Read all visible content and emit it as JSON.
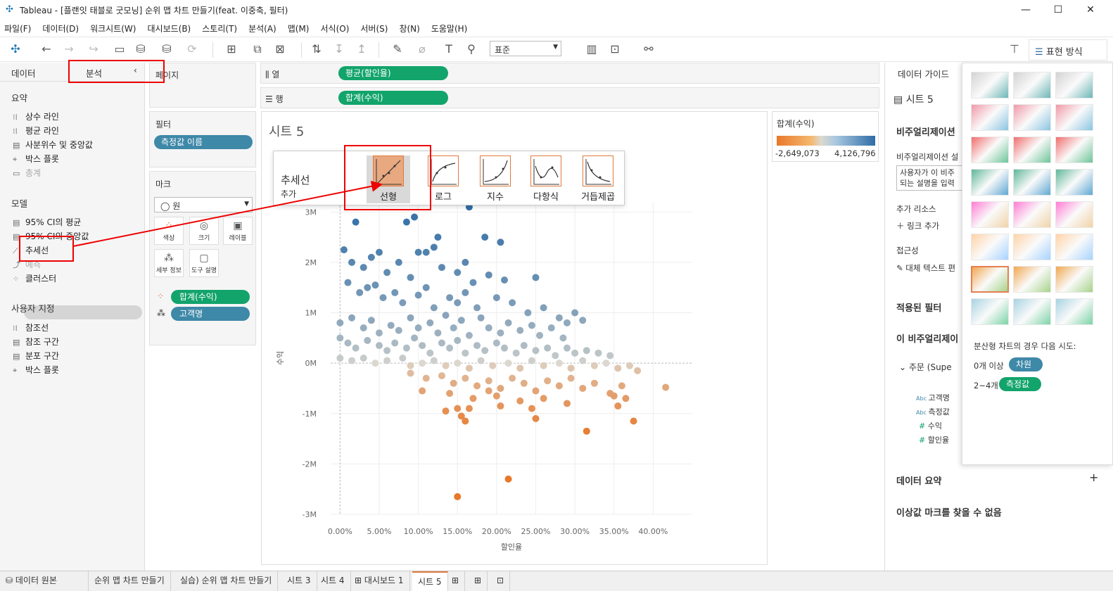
{
  "window": {
    "title": "Tableau - [플랜잇 태블로 굿모닝] 순위 맵 차트 만들기(feat. 이중축, 필터)",
    "min": "—",
    "max": "☐",
    "close": "✕"
  },
  "menu": [
    "파일(F)",
    "데이터(D)",
    "워크시트(W)",
    "대시보드(B)",
    "스토리(T)",
    "분석(A)",
    "맵(M)",
    "서식(O)",
    "서버(S)",
    "창(N)",
    "도움말(H)"
  ],
  "toolbar": {
    "fit": "표준",
    "showme": "표현 방식"
  },
  "left": {
    "tab_data": "데이터",
    "tab_analysis": "분석",
    "sections": {
      "summary": "요약",
      "model": "모델",
      "custom": "사용자 지정"
    },
    "summary_items": [
      "상수 라인",
      "평균 라인",
      "사분위수 및 중앙값",
      "박스 플롯",
      "총계"
    ],
    "model_items": [
      "95% CI의 평균",
      "95% CI의 중앙값",
      "추세선",
      "예측",
      "클러스터"
    ],
    "custom_items": [
      "참조선",
      "참조 구간",
      "분포 구간",
      "박스 플롯"
    ]
  },
  "shelves": {
    "pages": "페이지",
    "filters": "필터",
    "filter_pill": "측정값 이름",
    "marks": "마크",
    "mark_type": "원",
    "mark_buttons": [
      "색상",
      "크기",
      "레이블",
      "세부 정보",
      "도구 설명"
    ],
    "mark_pills": [
      "합계(수익)",
      "고객명"
    ],
    "columns_label": "열",
    "rows_label": "행",
    "columns_pill": "평균(할인율)",
    "rows_pill": "합계(수익)"
  },
  "sheet": {
    "title": "시트 5"
  },
  "legend": {
    "title": "합계(수익)",
    "min": "-2,649,073",
    "max": "4,126,796"
  },
  "trend_popup": {
    "title": "추세선",
    "subtitle": "추가",
    "models": [
      "선형",
      "로그",
      "지수",
      "다항식",
      "거듭제곱"
    ]
  },
  "chart_data": {
    "type": "scatter",
    "xlabel": "할인율",
    "ylabel": "수익",
    "x_ticks": [
      "0.00%",
      "5.00%",
      "10.00%",
      "15.00%",
      "20.00%",
      "25.00%",
      "30.00%",
      "35.00%",
      "40.00%"
    ],
    "y_ticks": [
      "3M",
      "2M",
      "1M",
      "0M",
      "-1M",
      "-2M",
      "-3M"
    ],
    "xlim": [
      -0.012,
      0.45
    ],
    "ylim": [
      -3.0,
      3.2
    ],
    "points": [
      [
        0.02,
        2.8
      ],
      [
        0.045,
        3.2
      ],
      [
        0.06,
        3.2
      ],
      [
        0.085,
        2.8
      ],
      [
        0.095,
        2.9
      ],
      [
        0.11,
        2.2
      ],
      [
        0.125,
        2.5
      ],
      [
        0.165,
        3.1
      ],
      [
        0.185,
        2.5
      ],
      [
        0.205,
        2.4
      ],
      [
        0.005,
        2.25
      ],
      [
        0.015,
        2.0
      ],
      [
        0.03,
        1.9
      ],
      [
        0.04,
        2.1
      ],
      [
        0.05,
        2.2
      ],
      [
        0.06,
        1.8
      ],
      [
        0.075,
        2.0
      ],
      [
        0.09,
        1.7
      ],
      [
        0.1,
        2.2
      ],
      [
        0.12,
        2.3
      ],
      [
        0.13,
        1.9
      ],
      [
        0.15,
        1.8
      ],
      [
        0.16,
        2.0
      ],
      [
        0.17,
        1.6
      ],
      [
        0.19,
        1.75
      ],
      [
        0.21,
        1.65
      ],
      [
        0.25,
        1.7
      ],
      [
        0.01,
        1.6
      ],
      [
        0.025,
        1.4
      ],
      [
        0.035,
        1.5
      ],
      [
        0.045,
        1.55
      ],
      [
        0.055,
        1.3
      ],
      [
        0.07,
        1.4
      ],
      [
        0.08,
        1.2
      ],
      [
        0.1,
        1.35
      ],
      [
        0.11,
        1.5
      ],
      [
        0.12,
        1.1
      ],
      [
        0.14,
        1.3
      ],
      [
        0.15,
        1.2
      ],
      [
        0.16,
        1.4
      ],
      [
        0.175,
        1.1
      ],
      [
        0.2,
        1.3
      ],
      [
        0.22,
        1.2
      ],
      [
        0.24,
        1.0
      ],
      [
        0.26,
        1.1
      ],
      [
        0.28,
        0.9
      ],
      [
        0.29,
        0.8
      ],
      [
        0.3,
        1.0
      ],
      [
        0.31,
        0.85
      ],
      [
        0.0,
        0.8
      ],
      [
        0.015,
        0.9
      ],
      [
        0.03,
        0.7
      ],
      [
        0.04,
        0.85
      ],
      [
        0.05,
        0.6
      ],
      [
        0.065,
        0.75
      ],
      [
        0.075,
        0.65
      ],
      [
        0.09,
        0.9
      ],
      [
        0.1,
        0.7
      ],
      [
        0.115,
        0.8
      ],
      [
        0.125,
        0.6
      ],
      [
        0.135,
        0.95
      ],
      [
        0.145,
        0.7
      ],
      [
        0.155,
        0.85
      ],
      [
        0.165,
        0.55
      ],
      [
        0.18,
        0.9
      ],
      [
        0.19,
        0.7
      ],
      [
        0.205,
        0.6
      ],
      [
        0.215,
        0.8
      ],
      [
        0.23,
        0.65
      ],
      [
        0.245,
        0.75
      ],
      [
        0.255,
        0.55
      ],
      [
        0.27,
        0.7
      ],
      [
        0.285,
        0.5
      ],
      [
        0.0,
        0.5
      ],
      [
        0.01,
        0.4
      ],
      [
        0.02,
        0.3
      ],
      [
        0.035,
        0.45
      ],
      [
        0.05,
        0.35
      ],
      [
        0.06,
        0.25
      ],
      [
        0.07,
        0.4
      ],
      [
        0.085,
        0.3
      ],
      [
        0.095,
        0.5
      ],
      [
        0.105,
        0.35
      ],
      [
        0.115,
        0.2
      ],
      [
        0.13,
        0.4
      ],
      [
        0.14,
        0.3
      ],
      [
        0.15,
        0.45
      ],
      [
        0.16,
        0.2
      ],
      [
        0.175,
        0.35
      ],
      [
        0.185,
        0.25
      ],
      [
        0.2,
        0.4
      ],
      [
        0.21,
        0.3
      ],
      [
        0.225,
        0.2
      ],
      [
        0.235,
        0.35
      ],
      [
        0.25,
        0.25
      ],
      [
        0.265,
        0.3
      ],
      [
        0.275,
        0.15
      ],
      [
        0.29,
        0.3
      ],
      [
        0.3,
        0.2
      ],
      [
        0.315,
        0.25
      ],
      [
        0.33,
        0.2
      ],
      [
        0.345,
        0.15
      ],
      [
        0.0,
        0.1
      ],
      [
        0.015,
        0.05
      ],
      [
        0.03,
        0.1
      ],
      [
        0.045,
        0.0
      ],
      [
        0.06,
        0.05
      ],
      [
        0.08,
        0.1
      ],
      [
        0.09,
        -0.05
      ],
      [
        0.105,
        0.0
      ],
      [
        0.12,
        0.05
      ],
      [
        0.135,
        -0.05
      ],
      [
        0.15,
        0.0
      ],
      [
        0.165,
        -0.1
      ],
      [
        0.18,
        0.05
      ],
      [
        0.195,
        -0.05
      ],
      [
        0.215,
        0.0
      ],
      [
        0.23,
        -0.1
      ],
      [
        0.245,
        0.05
      ],
      [
        0.26,
        -0.05
      ],
      [
        0.28,
        0.0
      ],
      [
        0.295,
        -0.1
      ],
      [
        0.31,
        0.05
      ],
      [
        0.325,
        -0.05
      ],
      [
        0.34,
        0.0
      ],
      [
        0.355,
        -0.1
      ],
      [
        0.37,
        -0.05
      ],
      [
        0.38,
        -0.15
      ],
      [
        0.09,
        -0.2
      ],
      [
        0.11,
        -0.3
      ],
      [
        0.13,
        -0.25
      ],
      [
        0.145,
        -0.4
      ],
      [
        0.16,
        -0.3
      ],
      [
        0.175,
        -0.45
      ],
      [
        0.19,
        -0.35
      ],
      [
        0.205,
        -0.5
      ],
      [
        0.22,
        -0.3
      ],
      [
        0.235,
        -0.4
      ],
      [
        0.25,
        -0.55
      ],
      [
        0.265,
        -0.35
      ],
      [
        0.28,
        -0.45
      ],
      [
        0.295,
        -0.3
      ],
      [
        0.31,
        -0.5
      ],
      [
        0.325,
        -0.4
      ],
      [
        0.345,
        -0.6
      ],
      [
        0.36,
        -0.45
      ],
      [
        0.105,
        -0.55
      ],
      [
        0.14,
        -0.6
      ],
      [
        0.17,
        -0.7
      ],
      [
        0.2,
        -0.65
      ],
      [
        0.23,
        -0.75
      ],
      [
        0.26,
        -0.7
      ],
      [
        0.29,
        -0.8
      ],
      [
        0.35,
        -0.65
      ],
      [
        0.365,
        -0.7
      ],
      [
        0.15,
        -0.9
      ],
      [
        0.135,
        -0.95
      ],
      [
        0.155,
        -1.05
      ],
      [
        0.165,
        -0.9
      ],
      [
        0.205,
        -0.85
      ],
      [
        0.245,
        -0.9
      ],
      [
        0.25,
        -1.1
      ],
      [
        0.355,
        -0.85
      ],
      [
        0.375,
        -1.15
      ],
      [
        0.315,
        -1.35
      ],
      [
        0.416,
        -0.48
      ],
      [
        0.215,
        -2.3
      ],
      [
        0.15,
        -2.65
      ],
      [
        0.16,
        -1.15
      ],
      [
        0.19,
        -0.55
      ]
    ],
    "colors": {
      "low": "#e8782a",
      "mid": "#dcd8cf",
      "high": "#2e6ca6"
    }
  },
  "guide": {
    "title": "데이터 가이드",
    "sheet": "시트 5",
    "viz": "비주얼리제이션",
    "viz_desc": "비주얼리제이션 설",
    "desc_input": "사용자가 이 비주",
    "desc_input2": "되는 설명을 입력",
    "resources": "추가 리소스",
    "add_link": "링크 추가",
    "access": "접근성",
    "alt_text": "대체 텍스트 편",
    "filters": "적용된 필터",
    "this_viz": "이 비주얼리제이",
    "order": "주문 (Supe",
    "fields": [
      "고객명",
      "측정값",
      "수익",
      "할인율"
    ],
    "summary": "데이터 요약",
    "outliers": "이상값 마크를 찾을 수 없음"
  },
  "showme": {
    "hint": "분산형 차트의 경우 다음 시도:",
    "dim_label": "0개 이상",
    "dim_pill": "차원",
    "mea_label": "2~4개",
    "mea_pill": "측정값"
  },
  "tabs": [
    "데이터 원본",
    "순위 맵 차트 만들기",
    "실습) 순위 맵 차트 만들기",
    "시트 3",
    "시트 4",
    "대시보드 1",
    "시트 5"
  ]
}
